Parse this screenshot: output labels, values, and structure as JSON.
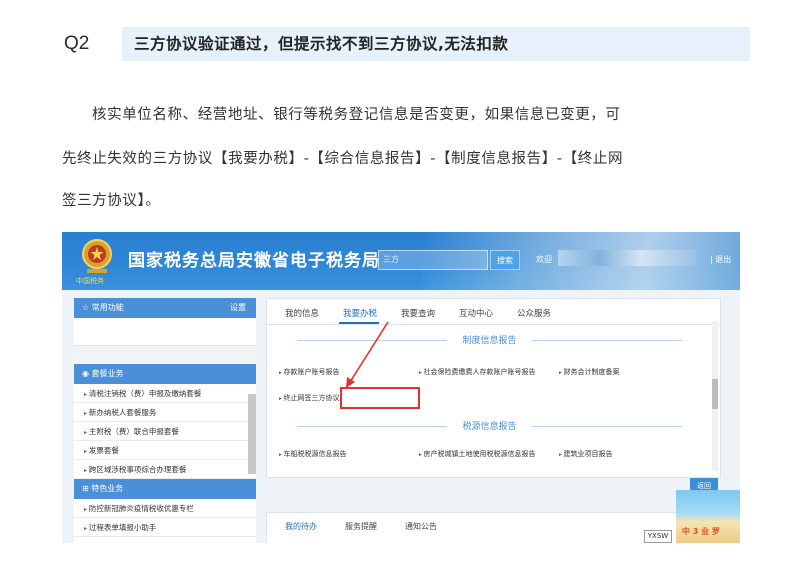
{
  "question": {
    "number": "Q2",
    "title": "三方协议验证通过，但提示找不到三方协议,无法扣款"
  },
  "paragraph": {
    "line1": "核实单位名称、经营地址、银行等税务登记信息是否变更，如果信息已变更，可",
    "line2": "先终止失效的三方协议【我要办税】-【综合信息报告】-【制度信息报告】-【终止网",
    "line3": "签三方协议】。"
  },
  "screenshot": {
    "site_title": "国家税务总局安徽省电子税务局",
    "emblem_caption": "中国税务",
    "search_placeholder": "三方",
    "search_button": "搜索",
    "welcome": "欢迎",
    "logout": "| 退出",
    "left_panel": {
      "header": "常用功能",
      "settings": "设置",
      "section1": "套餐业务",
      "items1": [
        "清税注销税（费）申报及缴纳套餐",
        "新办纳税人套餐服务",
        "主附税（费）联合申报套餐",
        "发票套餐",
        "跨区域涉税事项综合办理套餐"
      ],
      "section2": "特色业务",
      "items2": [
        "防控新冠肺炎疫情税收优惠专栏",
        "过程表单填报小助手"
      ]
    },
    "tabs": [
      "我的信息",
      "我要办税",
      "我要查询",
      "互动中心",
      "公众服务"
    ],
    "active_tab": "我要办税",
    "sections": {
      "institutional": "制度信息报告",
      "tax_source": "税源信息报告"
    },
    "items": {
      "deposit": "存款账户账号报告",
      "social": "社会保险费缴费人存款账户账号报告",
      "accounting": "财务会计制度备案",
      "terminate": "终止网签三方协议",
      "vehicle": "车船税税源信息报告",
      "property": "房产税城镇土地使用税税源信息报告",
      "construction": "建筑业项目报告"
    },
    "return_button": "返回",
    "bottom_tabs": [
      "我的待办",
      "服务提醒",
      "通知公告"
    ],
    "corner_badge": "YXSW",
    "beach_text": "中 3 业 罗"
  },
  "colors": {
    "accent": "#1f6fc9",
    "highlight": "#e5322d",
    "banner": "#2e86d6",
    "title_bar": "#e6f1fb"
  }
}
